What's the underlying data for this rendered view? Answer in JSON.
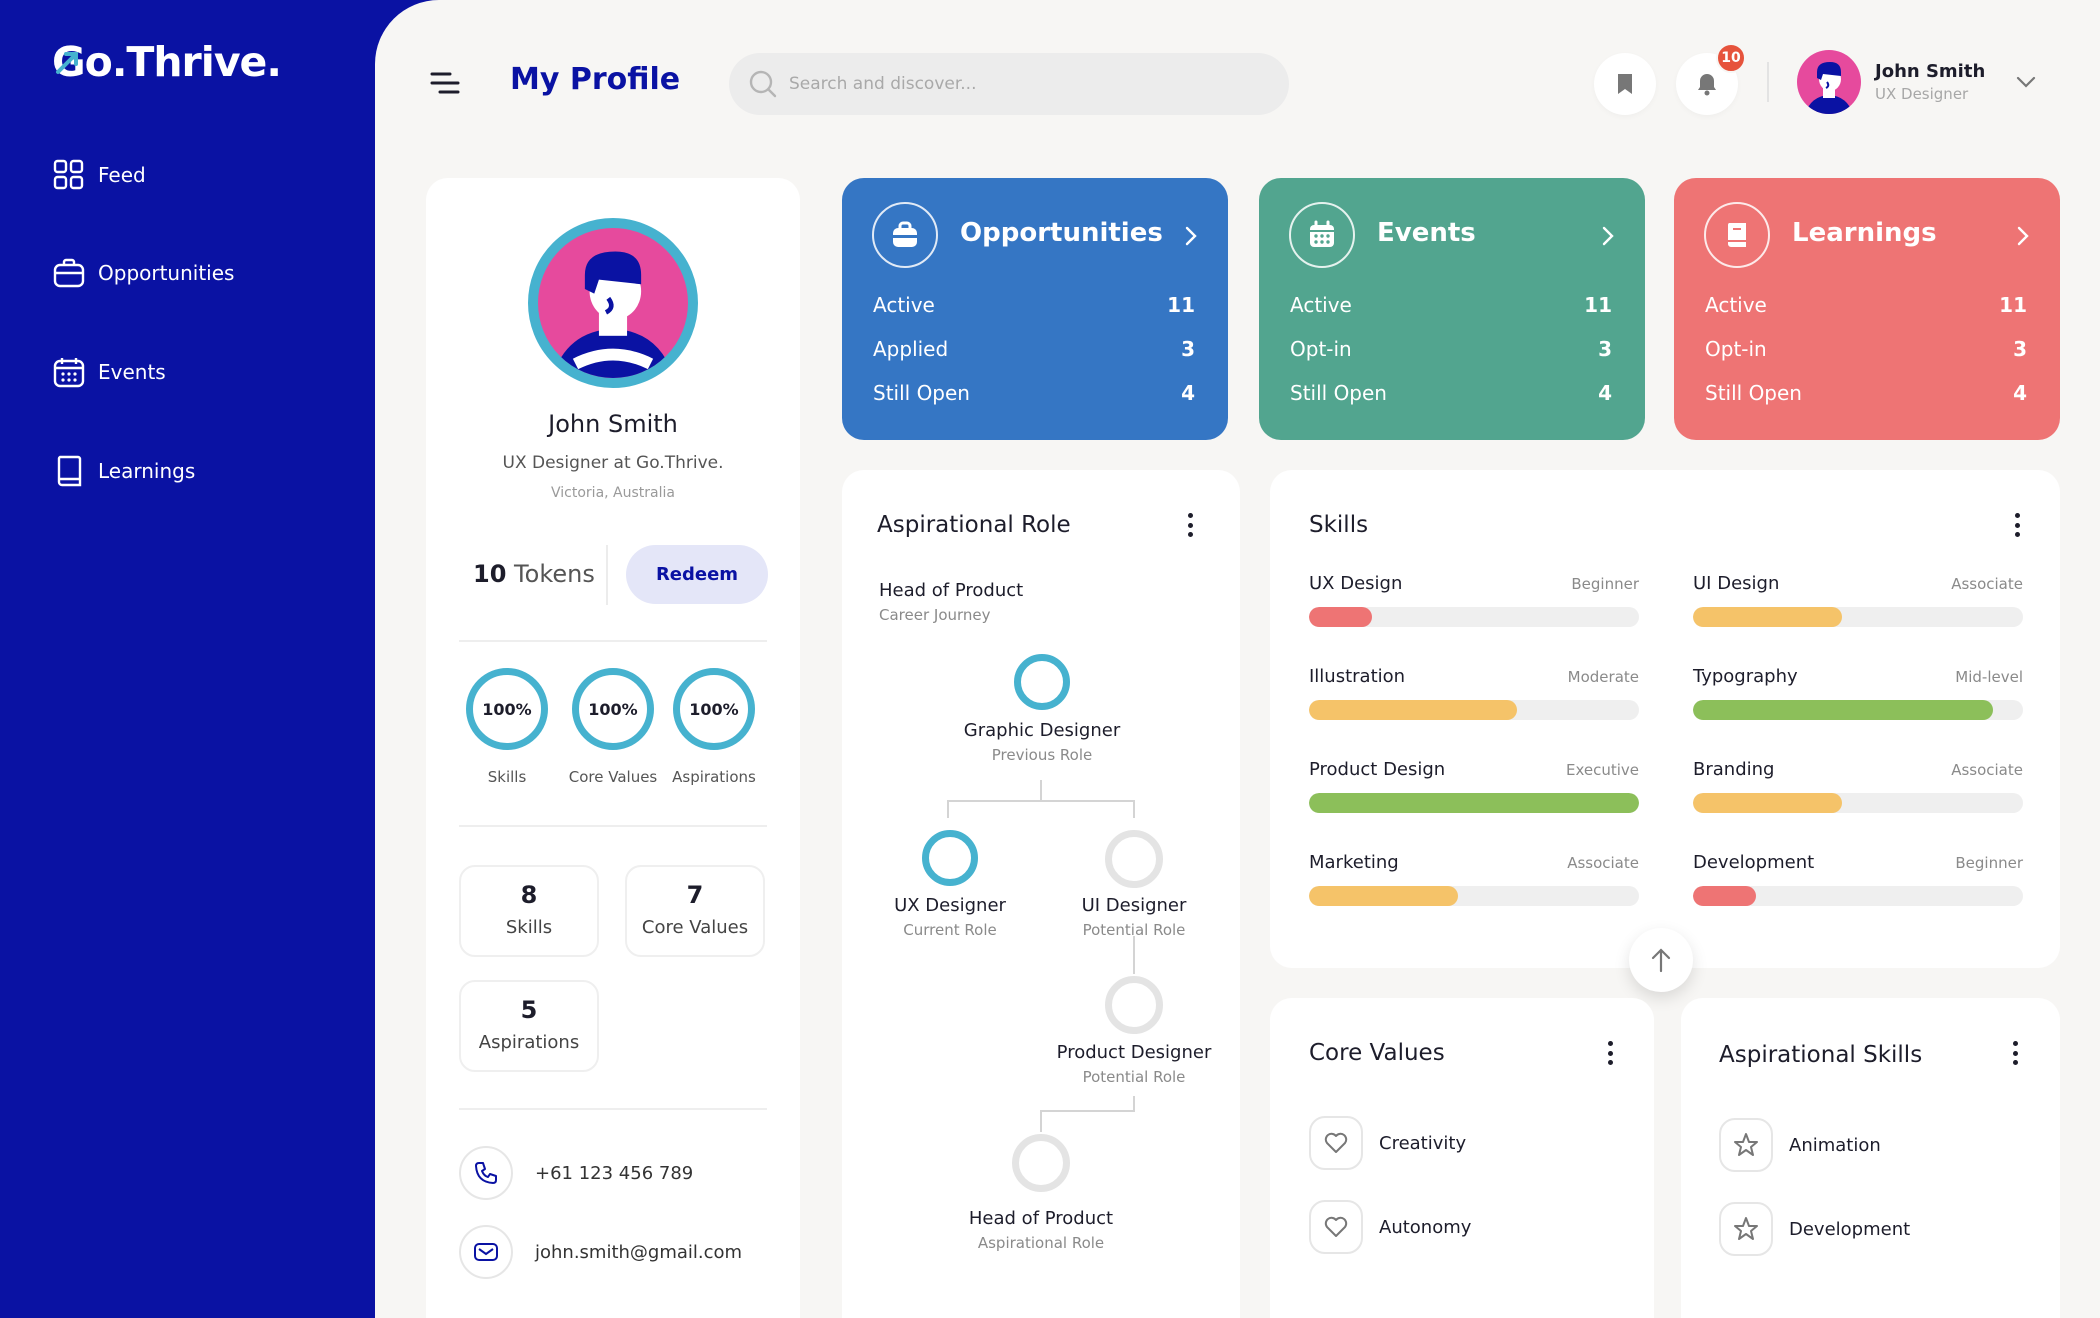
{
  "brand": {
    "logo_text": "Go.Thrive."
  },
  "nav": {
    "items": [
      {
        "label": "Feed"
      },
      {
        "label": "Opportunities"
      },
      {
        "label": "Events"
      },
      {
        "label": "Learnings"
      }
    ]
  },
  "header": {
    "title": "My Profile",
    "search_placeholder": "Search and discover...",
    "notification_count": "10",
    "user_name": "John Smith",
    "user_role": "UX Designer"
  },
  "profile": {
    "name": "John Smith",
    "title": "UX Designer at Go.Thrive.",
    "location": "Victoria, Australia",
    "tokens_count": "10",
    "tokens_label": "Tokens",
    "redeem_label": "Redeem",
    "progress": [
      {
        "value": "100%",
        "label": "Skills"
      },
      {
        "value": "100%",
        "label": "Core Values"
      },
      {
        "value": "100%",
        "label": "Aspirations"
      }
    ],
    "stats": [
      {
        "num": "8",
        "label": "Skills"
      },
      {
        "num": "7",
        "label": "Core Values"
      },
      {
        "num": "5",
        "label": "Aspirations"
      }
    ],
    "phone": "+61 123 456 789",
    "email": "john.smith@gmail.com"
  },
  "stat_cards": [
    {
      "title": "Opportunities",
      "color": "#3576c4",
      "rows": [
        {
          "label": "Active",
          "value": "11"
        },
        {
          "label": "Applied",
          "value": "3"
        },
        {
          "label": "Still Open",
          "value": "4"
        }
      ]
    },
    {
      "title": "Events",
      "color": "#52a58f",
      "rows": [
        {
          "label": "Active",
          "value": "11"
        },
        {
          "label": "Opt-in",
          "value": "3"
        },
        {
          "label": "Still Open",
          "value": "4"
        }
      ]
    },
    {
      "title": "Learnings",
      "color": "#ee7474",
      "rows": [
        {
          "label": "Active",
          "value": "11"
        },
        {
          "label": "Opt-in",
          "value": "3"
        },
        {
          "label": "Still Open",
          "value": "4"
        }
      ]
    }
  ],
  "aspirational_role": {
    "title": "Aspirational Role",
    "goal": "Head of Product",
    "goal_sub": "Career Journey",
    "nodes": [
      {
        "label": "Graphic Designer",
        "sub": "Previous Role"
      },
      {
        "label": "UX Designer",
        "sub": "Current Role"
      },
      {
        "label": "UI Designer",
        "sub": "Potential Role"
      },
      {
        "label": "Product Designer",
        "sub": "Potential Role"
      },
      {
        "label": "Head of Product",
        "sub": "Aspirational Role"
      }
    ]
  },
  "skills": {
    "title": "Skills",
    "items": [
      {
        "name": "UX Design",
        "level": "Beginner",
        "progress": 0.19,
        "color": "#ee7474"
      },
      {
        "name": "UI Design",
        "level": "Associate",
        "progress": 0.45,
        "color": "#f5c369"
      },
      {
        "name": "Illustration",
        "level": "Moderate",
        "progress": 0.63,
        "color": "#f5c369"
      },
      {
        "name": "Typography",
        "level": "Mid-level",
        "progress": 0.91,
        "color": "#8cbf5a"
      },
      {
        "name": "Product Design",
        "level": "Executive",
        "progress": 1.0,
        "color": "#8cbf5a"
      },
      {
        "name": "Branding",
        "level": "Associate",
        "progress": 0.45,
        "color": "#f5c369"
      },
      {
        "name": "Marketing",
        "level": "Associate",
        "progress": 0.45,
        "color": "#f5c369"
      },
      {
        "name": "Development",
        "level": "Beginner",
        "progress": 0.19,
        "color": "#ee7474"
      }
    ]
  },
  "core_values": {
    "title": "Core Values",
    "items": [
      {
        "label": "Creativity"
      },
      {
        "label": "Autonomy"
      }
    ]
  },
  "aspirational_skills": {
    "title": "Aspirational Skills",
    "items": [
      {
        "label": "Animation"
      },
      {
        "label": "Development"
      }
    ]
  }
}
